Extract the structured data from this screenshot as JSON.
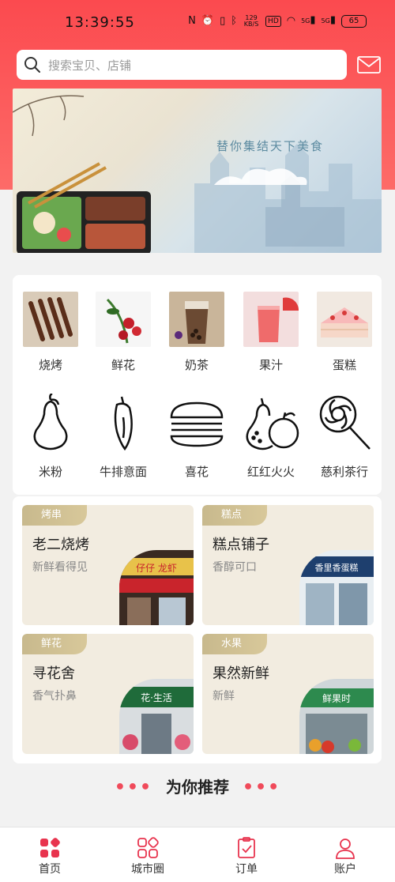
{
  "status_bar": {
    "time": "13:39:55",
    "speed": "129\nKB/S",
    "hd": "HD",
    "signal1": "5G",
    "signal2": "5G",
    "battery": "65"
  },
  "search": {
    "placeholder": "搜索宝贝、店铺"
  },
  "banner": {
    "title": "替你集结天下美食"
  },
  "categories_row1": [
    {
      "label": "烧烤",
      "icon": "skewer-photo"
    },
    {
      "label": "鲜花",
      "icon": "roses-photo"
    },
    {
      "label": "奶茶",
      "icon": "milk-tea-photo"
    },
    {
      "label": "果汁",
      "icon": "juice-photo"
    },
    {
      "label": "蛋糕",
      "icon": "cake-photo"
    }
  ],
  "categories_row2": [
    {
      "label": "米粉",
      "icon": "pear-icon"
    },
    {
      "label": "牛排意面",
      "icon": "chili-icon"
    },
    {
      "label": "喜花",
      "icon": "burger-icon"
    },
    {
      "label": "红红火火",
      "icon": "fruits-icon"
    },
    {
      "label": "慈利茶行",
      "icon": "lollipop-icon"
    }
  ],
  "shops": [
    {
      "tag": "烤串",
      "name": "老二烧烤",
      "desc": "新鲜看得见",
      "sign": "仔仔 龙虾"
    },
    {
      "tag": "糕点",
      "name": "糕点铺子",
      "desc": "香醇可口",
      "sign": "香里香蛋糕"
    },
    {
      "tag": "鲜花",
      "name": "寻花舍",
      "desc": "香气扑鼻",
      "sign": "花·生活"
    },
    {
      "tag": "水果",
      "name": "果然新鲜",
      "desc": "新鲜",
      "sign": "鲜果时"
    }
  ],
  "recommend": {
    "title": "为你推荐",
    "dots": "•••"
  },
  "tabbar": [
    {
      "label": "首页",
      "icon": "home-grid-icon",
      "active": true
    },
    {
      "label": "城市圈",
      "icon": "city-circle-icon",
      "active": false
    },
    {
      "label": "订单",
      "icon": "order-clipboard-icon",
      "active": false
    },
    {
      "label": "账户",
      "icon": "account-user-icon",
      "active": false
    }
  ],
  "colors": {
    "brand_red": "#fb4a4f",
    "accent_pink": "#e8344e",
    "tag_gold": "#c8b98d",
    "shop_bg": "#f2ece0"
  }
}
